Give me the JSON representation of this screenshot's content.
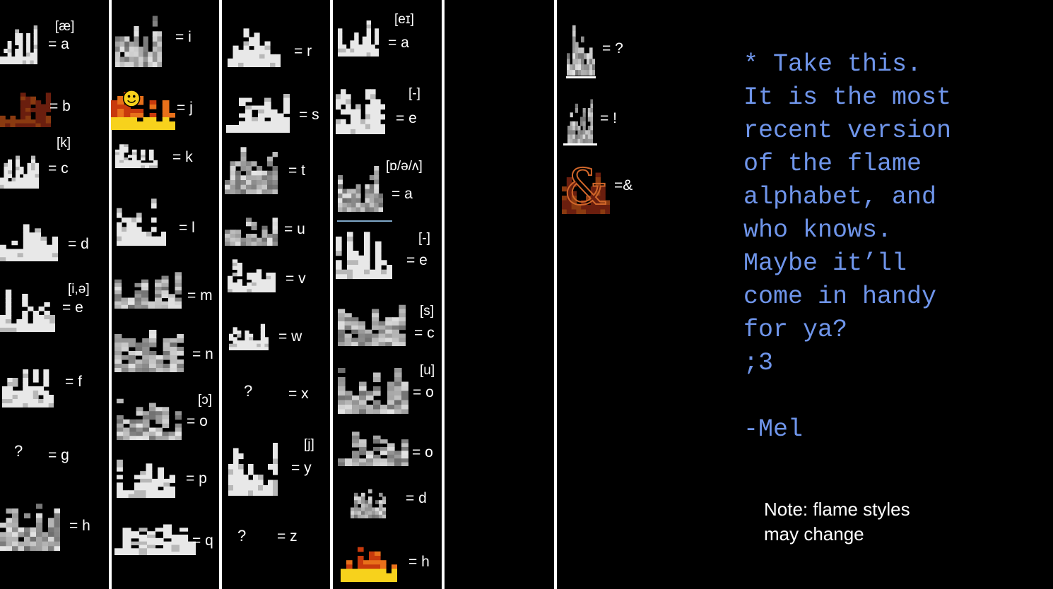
{
  "columns": [
    {
      "entries": [
        {
          "ipa": "[æ]",
          "label": "= a",
          "style": "light"
        },
        {
          "label": "= b",
          "style": "ember"
        },
        {
          "ipa": "[k]",
          "label": "= c",
          "style": "light"
        },
        {
          "label": "= d",
          "style": "light"
        },
        {
          "ipa": "[i,ə]",
          "label": "= e",
          "style": "light"
        },
        {
          "label": "= f",
          "style": "light"
        },
        {
          "glyph_unknown": "?",
          "label": "= g"
        },
        {
          "label": "= h",
          "style": "gray"
        }
      ]
    },
    {
      "entries": [
        {
          "label": "= i",
          "style": "gray"
        },
        {
          "label": "= j",
          "style": "fire"
        },
        {
          "label": "= k",
          "style": "light"
        },
        {
          "label": "= l",
          "style": "light"
        },
        {
          "label": "= m",
          "style": "gray"
        },
        {
          "label": "= n",
          "style": "gray"
        },
        {
          "ipa": "[ɔ]",
          "label": "= o",
          "style": "gray"
        },
        {
          "label": "= p",
          "style": "light"
        },
        {
          "label": "= q",
          "style": "light"
        }
      ]
    },
    {
      "entries": [
        {
          "label": "= r",
          "style": "light"
        },
        {
          "label": "= s",
          "style": "light"
        },
        {
          "label": "= t",
          "style": "gray"
        },
        {
          "label": "= u",
          "style": "gray"
        },
        {
          "label": "= v",
          "style": "light"
        },
        {
          "label": "= w",
          "style": "light"
        },
        {
          "glyph_unknown": "?",
          "label": "= x"
        },
        {
          "ipa": "[j]",
          "label": "= y",
          "style": "light"
        },
        {
          "glyph_unknown": "?",
          "label": "= z"
        }
      ]
    },
    {
      "entries": [
        {
          "ipa": "[eɪ]",
          "label": "= a",
          "style": "light"
        },
        {
          "ipa": "[-]",
          "label": "= e",
          "style": "light"
        },
        {
          "ipa": "[ɒ/ə/ʌ]",
          "label": "= a",
          "style": "gray"
        },
        {
          "ipa": "[-]",
          "label": "= e",
          "style": "light"
        },
        {
          "ipa": "[s]",
          "label": "= c",
          "style": "gray"
        },
        {
          "ipa": "[u]",
          "label": "= o",
          "style": "gray"
        },
        {
          "label": "= o",
          "style": "gray"
        },
        {
          "label": "= d",
          "style": "gray"
        },
        {
          "label": "= h",
          "style": "fire"
        }
      ]
    },
    {
      "entries": [
        {
          "label": "= ?",
          "style": "gray"
        },
        {
          "label": "= !",
          "style": "gray"
        },
        {
          "label": "=&",
          "style": "ember"
        }
      ]
    }
  ],
  "message": {
    "text": "* Take this.\nIt is the most\nrecent version\nof the flame\nalphabet, and\nwho knows.\nMaybe it’ll\ncome in handy\nfor ya?\n;3\n\n-Mel",
    "color": "#6f95ea"
  },
  "note": {
    "text": "Note: flame styles\nmay change"
  },
  "colors": {
    "background": "#000000",
    "divider": "#ffffff",
    "glyph_light": "#e8e8e8",
    "glyph_gray": "#9a9a9a",
    "fire_orange": "#e8701a",
    "fire_yellow": "#f7d21c",
    "ember_red": "#6a1e0e"
  },
  "icons": {
    "fire_j": "smiley-face-flame-icon",
    "fire_h": "flame-icon",
    "ember_b": "ember-wreath-icon",
    "ember_amp": "ampersand-ember-icon"
  }
}
